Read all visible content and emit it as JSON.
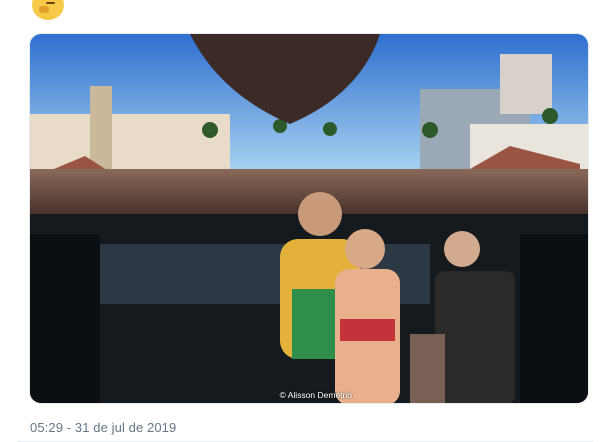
{
  "tweet": {
    "emoji": "thinking-face-icon",
    "photo": {
      "description_icon": "concert-stage-photo",
      "credit": "© Alisson Demetrio"
    },
    "timestamp": "05:29 - 31 de jul de 2019"
  },
  "colors": {
    "sky_top": "#2f6fd0",
    "sky_bottom": "#a9d4f0",
    "crowd": "#5a3a32",
    "stage": "#151a1f",
    "timestamp_text": "#657786"
  }
}
